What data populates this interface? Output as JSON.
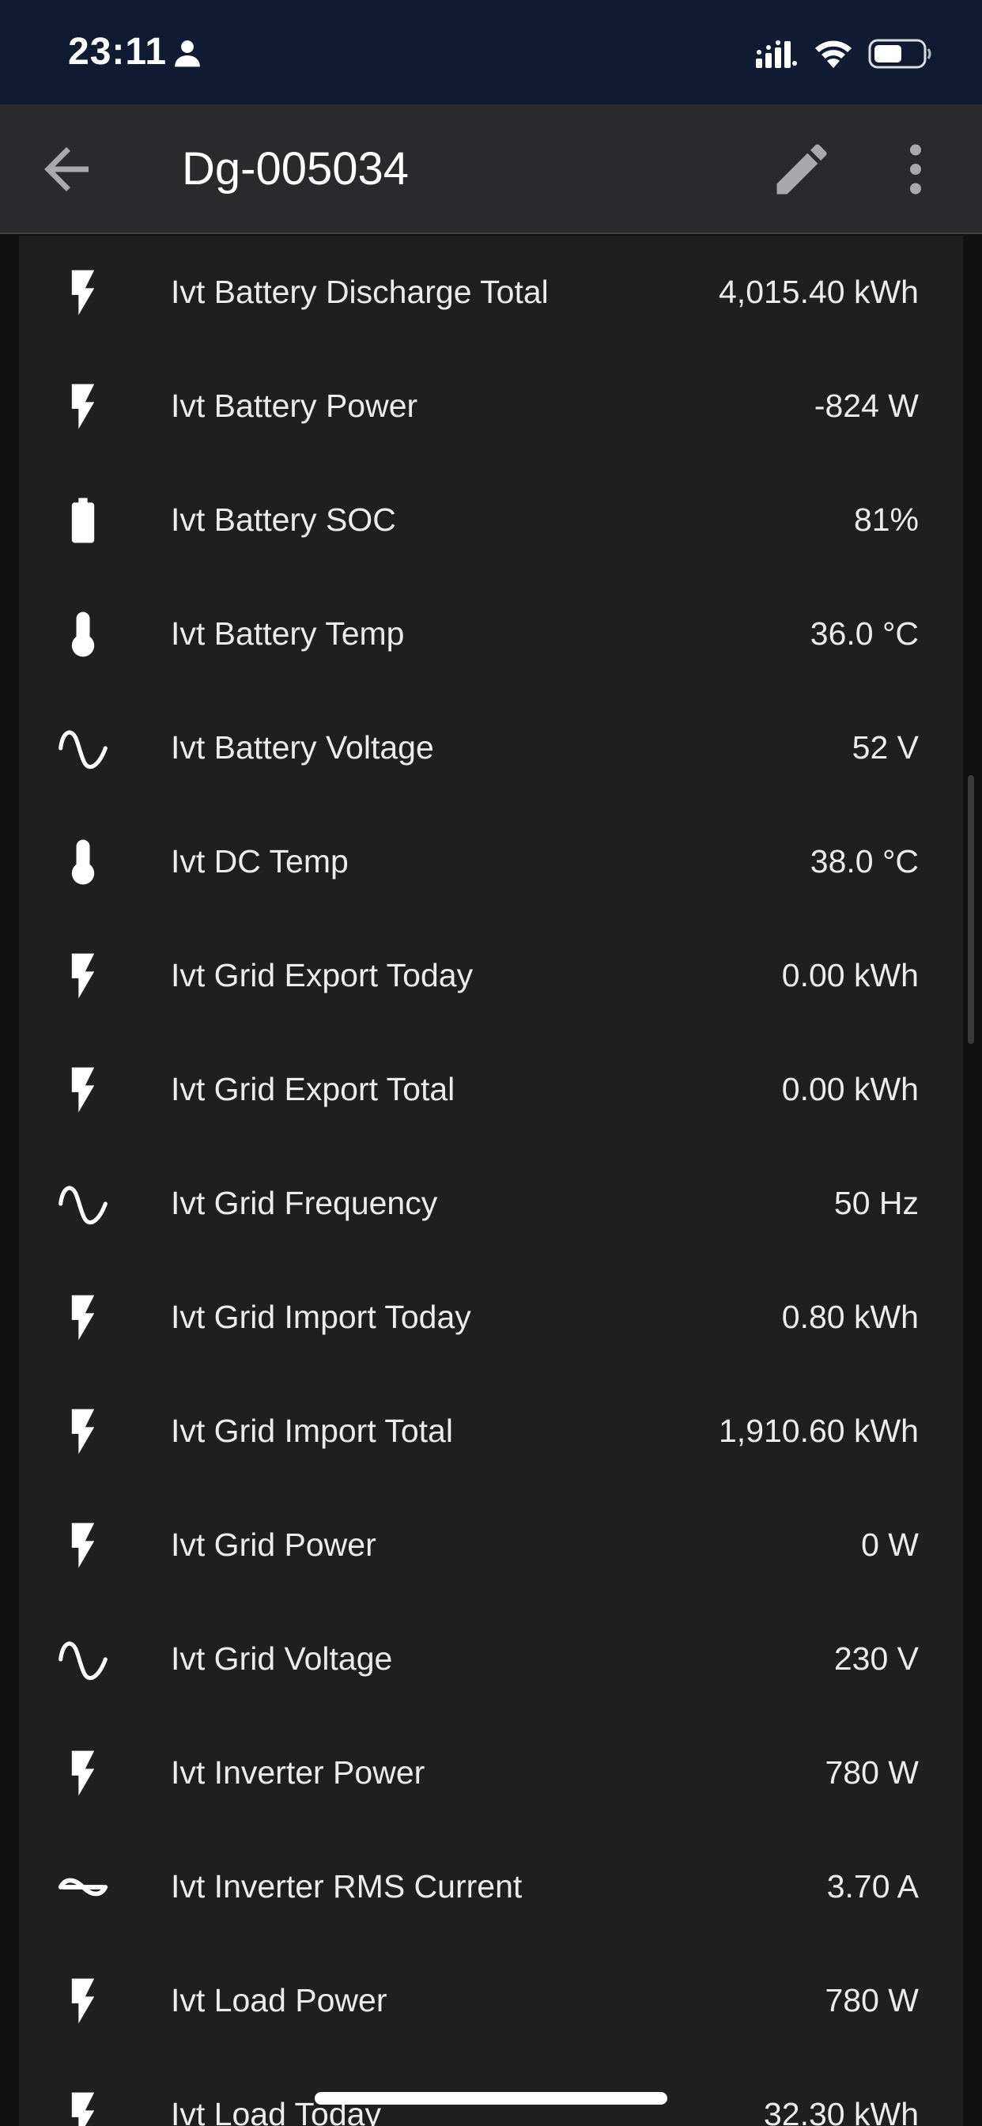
{
  "status_bar": {
    "time": "23:11",
    "colors": {
      "background": "#101a33"
    }
  },
  "app_bar": {
    "title": "Dg-005034",
    "back_icon": "arrow-left-icon",
    "edit_icon": "pencil-icon",
    "more_icon": "more-vertical-icon"
  },
  "rows": [
    {
      "icon": "flash-icon",
      "name": "Ivt Battery Discharge Total",
      "value": "4,015.40 kWh"
    },
    {
      "icon": "flash-icon",
      "name": "Ivt Battery Power",
      "value": "-824 W"
    },
    {
      "icon": "battery-icon",
      "name": "Ivt Battery SOC",
      "value": "81%"
    },
    {
      "icon": "thermometer-icon",
      "name": "Ivt Battery Temp",
      "value": "36.0 °C"
    },
    {
      "icon": "sine-wave-icon",
      "name": "Ivt Battery Voltage",
      "value": "52 V"
    },
    {
      "icon": "thermometer-icon",
      "name": "Ivt DC Temp",
      "value": "38.0 °C"
    },
    {
      "icon": "flash-icon",
      "name": "Ivt Grid Export Today",
      "value": "0.00 kWh"
    },
    {
      "icon": "flash-icon",
      "name": "Ivt Grid Export Total",
      "value": "0.00 kWh"
    },
    {
      "icon": "sine-wave-icon",
      "name": "Ivt Grid Frequency",
      "value": "50 Hz"
    },
    {
      "icon": "flash-icon",
      "name": "Ivt Grid Import Today",
      "value": "0.80 kWh"
    },
    {
      "icon": "flash-icon",
      "name": "Ivt Grid Import Total",
      "value": "1,910.60 kWh"
    },
    {
      "icon": "flash-icon",
      "name": "Ivt Grid Power",
      "value": "0 W"
    },
    {
      "icon": "sine-wave-icon",
      "name": "Ivt Grid Voltage",
      "value": "230 V"
    },
    {
      "icon": "flash-icon",
      "name": "Ivt Inverter Power",
      "value": "780 W"
    },
    {
      "icon": "current-ac-icon",
      "name": "Ivt Inverter RMS Current",
      "value": "3.70 A"
    },
    {
      "icon": "flash-icon",
      "name": "Ivt Load Power",
      "value": "780 W"
    },
    {
      "icon": "flash-icon",
      "name": "Ivt Load Today",
      "value": "32.30 kWh"
    }
  ],
  "colors": {
    "card_background": "#1f1f1f",
    "page_background": "#111111",
    "app_bar_background": "#2a2a2c",
    "text": "#ececec",
    "icon": "#ffffff"
  }
}
